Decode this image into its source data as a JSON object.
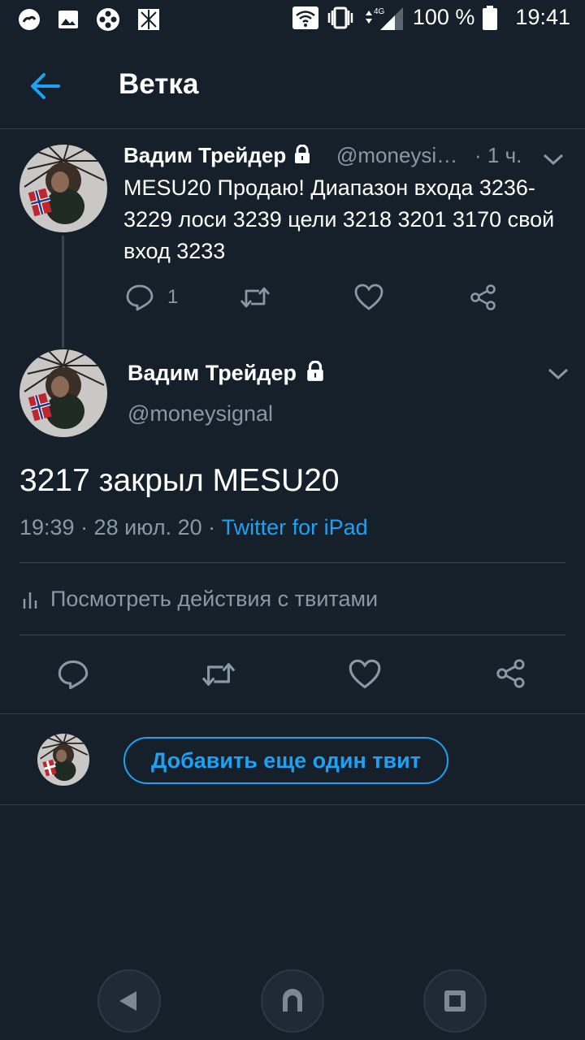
{
  "status_bar": {
    "battery": "100 %",
    "time": "19:41",
    "network": "4G"
  },
  "header": {
    "title": "Ветка"
  },
  "parent_tweet": {
    "author": "Вадим Трейдер",
    "handle": "@moneysi…",
    "time": "· 1 ч.",
    "text": "MESU20 Продаю! Диапазон входа 3236-3229 лоси 3239 цели 3218 3201 3170 свой вход 3233",
    "reply_count": "1"
  },
  "main_tweet": {
    "author": "Вадим Трейдер",
    "handle": "@moneysignal",
    "text": "3217 закрыл MESU20",
    "timestamp": "19:39 · 28 июл. 20 · ",
    "source": "Twitter for iPad",
    "activity_label": "Посмотреть действия с твитами"
  },
  "compose": {
    "add_tweet_label": "Добавить еще один твит"
  },
  "colors": {
    "background": "#15202b",
    "accent": "#1da1f2",
    "secondary_text": "#8899a6",
    "divider": "#38444d"
  },
  "icons": [
    "back-arrow-icon",
    "lock-icon",
    "chevron-down-icon",
    "reply-icon",
    "retweet-icon",
    "like-icon",
    "share-icon",
    "analytics-icon",
    "nav-back-icon",
    "nav-home-icon",
    "nav-recents-icon"
  ]
}
